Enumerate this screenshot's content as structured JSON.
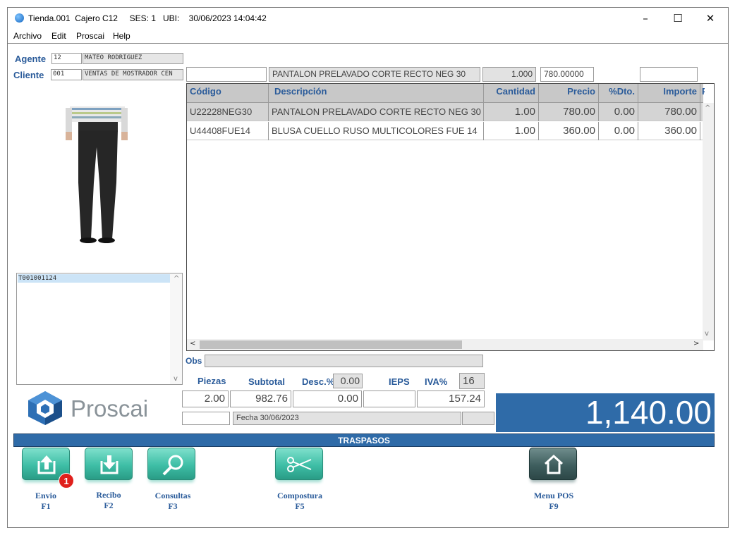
{
  "window": {
    "title": "Tienda.001  Cajero C12     SES: 1   UBI:    30/06/2023 14:04:42",
    "controls": {
      "minimize": "–",
      "maximize": "☐",
      "close": "✕"
    }
  },
  "menu": [
    "Archivo",
    "Edit",
    "Proscai",
    "Help"
  ],
  "agente": {
    "label": "Agente",
    "code": "12",
    "name": "MATEO RODRIGUEZ"
  },
  "cliente": {
    "label": "Cliente",
    "code": "001",
    "name": "VENTAS DE MOSTRADOR CEN"
  },
  "entry": {
    "code": "",
    "description": "PANTALON PRELAVADO CORTE RECTO NEG 30",
    "quantity": "1.000",
    "price": "780.00000",
    "extra": ""
  },
  "grid": {
    "headers": [
      "Código",
      "Descripción",
      "Cantidad",
      "Precio",
      "%Dto.",
      "Importe",
      "P"
    ],
    "rows": [
      {
        "codigo": "U22228NEG30",
        "descripcion": "PANTALON PRELAVADO CORTE RECTO NEG 30",
        "cantidad": "1.00",
        "precio": "780.00",
        "dto": "0.00",
        "importe": "780.00"
      },
      {
        "codigo": "U44408FUE14",
        "descripcion": "BLUSA CUELLO RUSO MULTICOLORES FUE 14",
        "cantidad": "1.00",
        "precio": "360.00",
        "dto": "0.00",
        "importe": "360.00"
      }
    ]
  },
  "ticket_list": {
    "selected": "T001001124"
  },
  "obs": {
    "label": "Obs",
    "value": ""
  },
  "summary": {
    "piezas_label": "Piezas",
    "piezas": "2.00",
    "subtotal_label": "Subtotal",
    "subtotal": "982.76",
    "desc_label": "Desc.%",
    "desc_pct": "0.00",
    "desc": "0.00",
    "ieps_label": "IEPS",
    "ieps": "",
    "iva_label": "IVA%",
    "iva_pct": "16",
    "iva": "157.24",
    "fecha": "Fecha 30/06/2023"
  },
  "total": "1,140.00",
  "logo": {
    "text": "Proscai"
  },
  "section_title": "TRASPASOS",
  "function_buttons": [
    {
      "label": "Envio",
      "key": "F1",
      "icon": "upload-icon",
      "badge": "1"
    },
    {
      "label": "Recibo",
      "key": "F2",
      "icon": "download-icon"
    },
    {
      "label": "Consultas",
      "key": "F3",
      "icon": "magnifier-icon"
    },
    {
      "label": "Compostura",
      "key": "F5",
      "icon": "scissors-icon"
    },
    {
      "label": "Menu POS",
      "key": "F9",
      "icon": "home-icon"
    }
  ],
  "colors": {
    "accent_blue": "#2f6ba8",
    "label_blue": "#2a5b9a",
    "button_teal": "#3ebea6",
    "button_dark": "#3e5e5e",
    "badge_red": "#e0201c"
  }
}
